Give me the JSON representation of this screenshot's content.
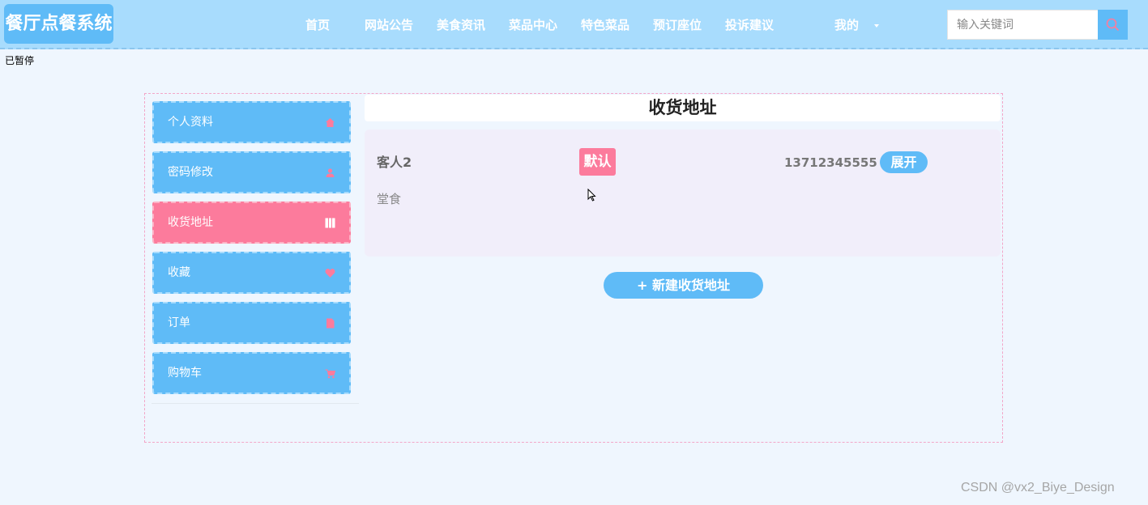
{
  "header": {
    "logo": "餐厅点餐系统",
    "nav": [
      "首页",
      "网站公告",
      "美食资讯",
      "菜品中心",
      "特色菜品",
      "预订座位",
      "投诉建议",
      "我的"
    ],
    "search_placeholder": "输入关键词"
  },
  "paused_text": "已暂停",
  "sidebar": {
    "items": [
      {
        "label": "个人资料",
        "icon": "home-icon"
      },
      {
        "label": "密码修改",
        "icon": "user-icon"
      },
      {
        "label": "收货地址",
        "icon": "columns-icon",
        "active": true
      },
      {
        "label": "收藏",
        "icon": "heart-icon"
      },
      {
        "label": "订单",
        "icon": "document-icon"
      },
      {
        "label": "购物车",
        "icon": "cart-icon"
      }
    ]
  },
  "main": {
    "title": "收货地址",
    "address": {
      "name": "客人2",
      "default_label": "默认",
      "phone": "13712345555",
      "expand_label": "展开",
      "detail": "堂食"
    },
    "new_address_label": "+ 新建收货地址"
  },
  "watermark": "CSDN @vx2_Biye_Design",
  "colors": {
    "header_bg": "#a8dcfd",
    "primary": "#5fbbf7",
    "accent_pink": "#fc7b9c",
    "page_bg": "#eff6fe"
  }
}
